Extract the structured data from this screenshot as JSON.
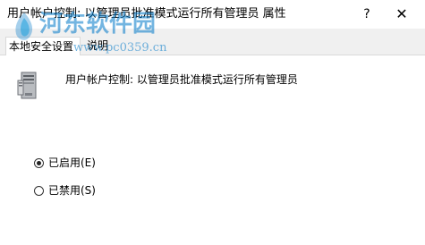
{
  "window": {
    "title": "用户帐户控制: 以管理员批准模式运行所有管理员 属性",
    "help_glyph": "?",
    "close_glyph": "✕"
  },
  "tabs": [
    {
      "label": "本地安全设置",
      "active": true
    },
    {
      "label": "说明",
      "active": false
    }
  ],
  "policy": {
    "icon": "computer-tower-icon",
    "name": "用户帐户控制: 以管理员批准模式运行所有管理员"
  },
  "options": [
    {
      "label": "已启用(E)",
      "checked": true
    },
    {
      "label": "已禁用(S)",
      "checked": false
    }
  ],
  "watermark": {
    "title": "河东软件园",
    "url": "www.pc0359.cn"
  },
  "colors": {
    "tab_strip": "#f0f0f0",
    "watermark": "#0078c8"
  }
}
